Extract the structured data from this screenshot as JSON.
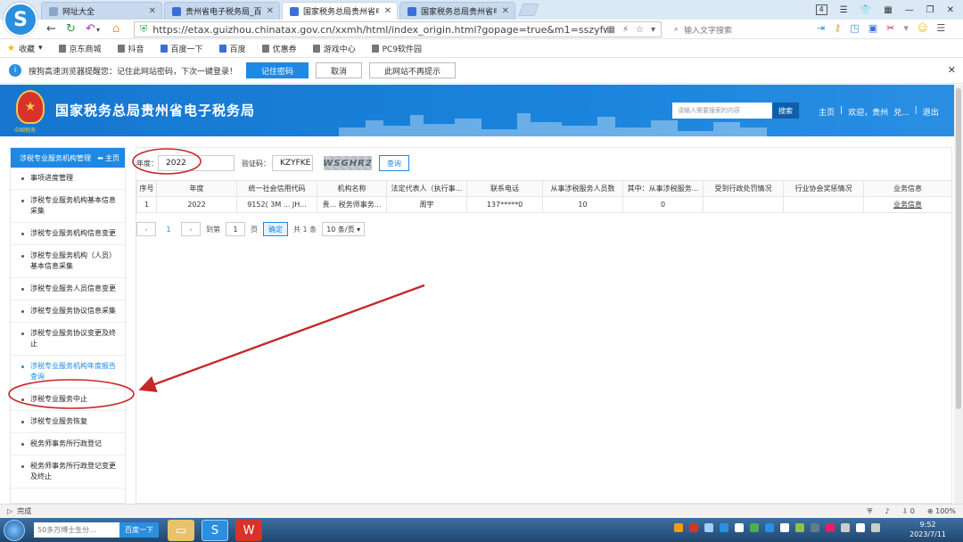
{
  "browser": {
    "tabs": [
      {
        "label": "网址大全"
      },
      {
        "label": "贵州省电子税务局_百度"
      },
      {
        "label": "国家税务总局贵州省电子"
      },
      {
        "label": "国家税务总局贵州省电子"
      }
    ],
    "window_badge": "4",
    "url": "https://etax.guizhou.chinatax.gov.cn/xxmh/html/index_origin.html?gopage=true&m1=sszyfwjggl&m2",
    "search_placeholder": "输入文字搜索"
  },
  "bookmarks": [
    {
      "label": "收藏"
    },
    {
      "label": "京东商城"
    },
    {
      "label": "抖音"
    },
    {
      "label": "百度一下"
    },
    {
      "label": "百度"
    },
    {
      "label": "优惠券"
    },
    {
      "label": "游戏中心"
    },
    {
      "label": "PC9软件园"
    }
  ],
  "notify": {
    "text": "搜狗高速浏览器提醒您：记住此网站密码，下次一键登录！",
    "remember": "记住密码",
    "cancel": "取消",
    "never": "此网站不再提示"
  },
  "site": {
    "title": "国家税务总局贵州省电子税务局",
    "emblem_text": "中国税务",
    "search_placeholder": "请输入需要搜索的内容",
    "search_btn": "搜索",
    "links": [
      "主页",
      "|",
      "欢迎，贵州",
      "兑...",
      "|",
      "退出"
    ]
  },
  "sidebar": {
    "header": "涉税专业服务机构管理",
    "home": "主页",
    "items": [
      {
        "label": "事项进度管理"
      },
      {
        "label": "涉税专业服务机构基本信息采集"
      },
      {
        "label": "涉税专业服务机构信息变更"
      },
      {
        "label": "涉税专业服务机构（人员）基本信息采集"
      },
      {
        "label": "涉税专业服务人员信息变更"
      },
      {
        "label": "涉税专业服务协议信息采集"
      },
      {
        "label": "涉税专业服务协议变更及终止"
      },
      {
        "label": "涉税专业服务机构年度报告查询"
      },
      {
        "label": "涉税专业服务中止"
      },
      {
        "label": "涉税专业服务恢复"
      },
      {
        "label": "税务师事务所行政登记"
      },
      {
        "label": "税务师事务所行政登记变更及终止"
      }
    ]
  },
  "filters": {
    "year_label": "年度：",
    "year_value": "2022",
    "captcha_label": "验证码：",
    "captcha_value": "KZYFKE",
    "captcha_image": "WSGHR2",
    "query": "查询"
  },
  "table": {
    "headers": [
      "序号",
      "年度",
      "统一社会信用代码",
      "机构名称",
      "法定代表人（执行事...",
      "联系电话",
      "从事涉税服务人员数",
      "其中：从事涉税服务...",
      "受到行政处罚情况",
      "行业协会奖惩情况",
      "业务信息"
    ],
    "rows": [
      [
        "1",
        "2022",
        "9152( 3M  ... JH...",
        "贵... 税务师事务...",
        "周宇",
        "137*****0",
        "10",
        "0",
        "",
        "",
        "业务信息"
      ]
    ]
  },
  "pager": {
    "page": "1",
    "goto_label": "到第",
    "goto_value": "1",
    "page_unit": "页",
    "ok": "确定",
    "total": "共 1 条",
    "page_size": "10 条/页"
  },
  "status": {
    "text": "完成",
    "downloads": "0",
    "zoom": "100%"
  },
  "taskbar": {
    "search_placeholder": "50多万博士生分...",
    "search_btn": "百度一下",
    "time": "9:52",
    "date": "2023/7/11"
  },
  "colors": {
    "accent": "#1e88e5",
    "header_blue": "#1a7fd6",
    "annotation_red": "#c62828"
  }
}
